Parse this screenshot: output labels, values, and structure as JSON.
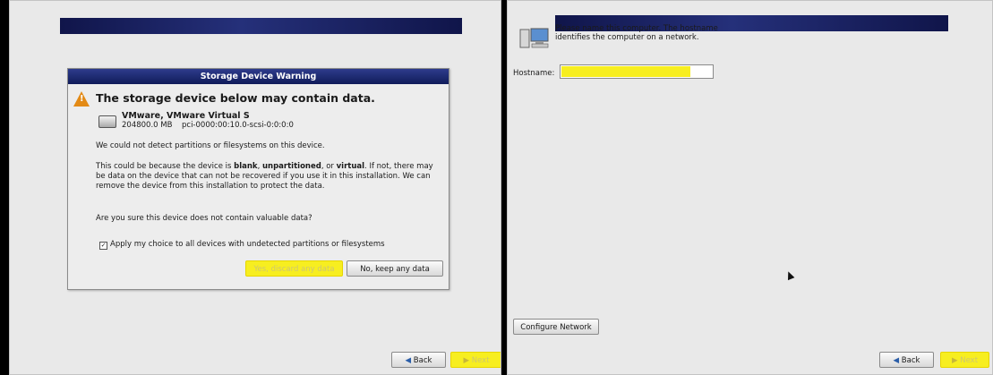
{
  "left_panel": {
    "dialog": {
      "title": "Storage Device Warning",
      "heading": "The storage device below may contain data.",
      "device_name": "VMware, VMware Virtual S",
      "device_size": "204800.0 MB",
      "device_path": "pci-0000:00:10.0-scsi-0:0:0:0",
      "p1": "We could not detect partitions or filesystems on this device.",
      "p2_a": "This could be because the device is ",
      "p2_blank": "blank",
      "p2_comma": ", ",
      "p2_unpartitioned": "unpartitioned",
      "p2_b": ", or ",
      "p2_virtual": "virtual",
      "p2_c": ". If not, there may be data on the device that can not be recovered if you use it in this installation. We can remove the device from this installation to protect the data.",
      "p3": "Are you sure this device does not contain valuable data?",
      "apply_all_label": "Apply my choice to all devices with undetected partitions or filesystems",
      "apply_all_checked": true,
      "discard_button": "Yes, discard any data",
      "keep_button": "No, keep any data"
    },
    "back_button": "Back",
    "next_button": "Next"
  },
  "right_panel": {
    "prompt_text": "Please name this computer.  The hostname identifies the computer on a network.",
    "hostname_label": "Hostname:",
    "hostname_value": "",
    "configure_network_button": "Configure Network",
    "back_button": "Back",
    "next_button": "Next"
  },
  "colors": {
    "highlight": "#f7ee20",
    "title_bar": "#1b2a78",
    "warning_icon": "#e38a16"
  }
}
